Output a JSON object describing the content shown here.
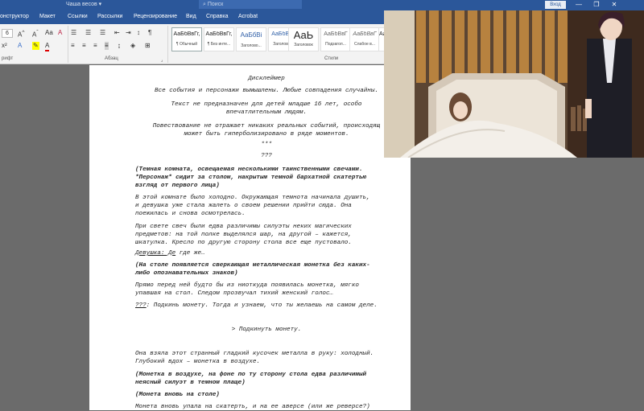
{
  "titlebar": {
    "doc_title": "Чаша весов ▾",
    "search_placeholder": "Поиск",
    "signin": "Вход",
    "min": "—",
    "max": "❐",
    "close": "✕"
  },
  "tabs": [
    "онструктор",
    "Макет",
    "Ссылки",
    "Рассылки",
    "Рецензирование",
    "Вид",
    "Справка",
    "Acrobat"
  ],
  "ribbon": {
    "font_label": "рифт",
    "para_label": "Абзац",
    "styles_label": "Стили",
    "font_size": "6",
    "styles": [
      {
        "preview": "АаБбВвГг,",
        "name": "¶ Обычный"
      },
      {
        "preview": "АаБбВвГг,",
        "name": "¶ Без инте..."
      },
      {
        "preview": "АаБбВі",
        "name": "Заголово..."
      },
      {
        "preview": "АаБбВвГ",
        "name": "Заголово..."
      },
      {
        "preview": "АаЬ",
        "name": "Заголовок"
      },
      {
        "preview": "АаБбВвГ",
        "name": "Подзагол..."
      },
      {
        "preview": "АаБбВвГ",
        "name": "Слабое в..."
      },
      {
        "preview": "АаБбВ",
        "name": ""
      }
    ]
  },
  "document": {
    "disclaimer_title": "Дисклеймер",
    "line1": "Все события и персонажи вымышлены. Любые совпадения случайны.",
    "line2a": "Текст не предназначен для детей младше 16 лет, особо",
    "line2b": "впечатлительным людям.",
    "line3a": "Повествование не отражает никаких реальных событий, происходящ",
    "line3b": "может быть гиперболизировано в ряде моментов.",
    "stars": "***",
    "qqq": "???",
    "s1a": "(Темная комната, освещаемая несколькими таинственными свечами.",
    "s1b": "*Персонаж* сидит за столом, накрытым темной бархатной скатертью",
    "s1c": "взгляд от первого лица)",
    "p1a": "В этой комнате было холодно. Окружающая темнота начинала душить,",
    "p1b": "и девушка уже стала жалеть о своем решении прийти сюда. Она",
    "p1c": "поежилась и снова осмотрелась.",
    "p2a": "При свете свеч были едва различимы силуэты неких магических",
    "p2b": "предметов: на той полке выделялся шар, на другой – кажется,",
    "p2c": "шкатулка. Кресло по другую сторону стола все еще пустовало.",
    "d1_speaker": "Девушка: Де",
    "d1_text": " где же…",
    "s2a": "(На столе появляется сверкающая металлическая монетка без каких-",
    "s2b": "либо опознавательных знаков)",
    "p3a": "Прямо перед ней будто бы из ниоткуда появилась монетка, мягко",
    "p3b": "упавшая на стол. Следом прозвучал тихий женский голос…",
    "d2_speaker": "???",
    "d2_text": ": Подкинь монету. Тогда и узнаем, что ты желаешь на самом деле.",
    "choice": "> Подкинуть монету.",
    "p4a": "Она взяла этот странный гладкий кусочек металла в руку: холодный.",
    "p4b": "Глубокий вдох – монетка в воздухе.",
    "s3a": "(Монетка в воздухе, на фоне по ту сторону стола едва различимый",
    "s3b": "неясный силуэт в темном плаще)",
    "s4": "(Монета вновь на столе)",
    "p5": "Монета вновь упала на скатерть, и на ее аверсе (или же реверсе?)"
  }
}
